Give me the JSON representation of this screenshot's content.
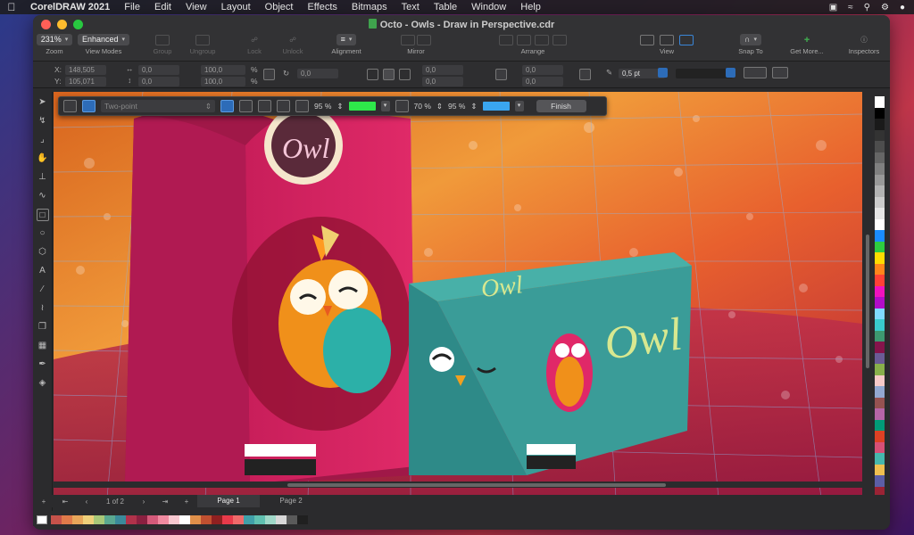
{
  "menubar": {
    "app_name": "CorelDRAW 2021",
    "items": [
      "File",
      "Edit",
      "View",
      "Layout",
      "Object",
      "Effects",
      "Bitmaps",
      "Text",
      "Table",
      "Window",
      "Help"
    ]
  },
  "window": {
    "title": "Octo - Owls - Draw in Perspective.cdr"
  },
  "toolbar": {
    "zoom_value": "231%",
    "zoom_label": "Zoom",
    "view_mode_value": "Enhanced",
    "view_mode_label": "View Modes",
    "group_label": "Group",
    "ungroup_label": "Ungroup",
    "lock_label": "Lock",
    "unlock_label": "Unlock",
    "alignment_label": "Alignment",
    "mirror_label": "Mirror",
    "arrange_label": "Arrange",
    "view_label": "View",
    "snap_label": "Snap To",
    "getmore_label": "Get More...",
    "inspectors_label": "Inspectors"
  },
  "propbar": {
    "x_label": "X:",
    "x_value": "148,505",
    "y_label": "Y:",
    "y_value": "105,071",
    "w_value": "0,0",
    "h_value": "0,0",
    "sw_value": "100,0",
    "sh_value": "100,0",
    "pct1": "%",
    "pct2": "%",
    "angle_value": "0,0",
    "corner1": "0,0",
    "corner2": "0,0",
    "corner3": "0,0",
    "corner4": "0,0",
    "outline_width": "0,5 pt"
  },
  "perspective_bar": {
    "mode_value": "Two-point",
    "opacity1": "95 %",
    "opacity2": "70 %",
    "opacity3": "95 %",
    "color1": "#2ee84a",
    "color2": "#3aa6f0",
    "finish_label": "Finish"
  },
  "canvas": {
    "bag_logo": "Owl",
    "box_logo_top": "Owl",
    "box_logo_side": "Owl"
  },
  "pagebar": {
    "page_count": "1 of 2",
    "pages": [
      "Page 1",
      "Page 2"
    ]
  },
  "palette_colors": [
    "#ffffff",
    "#000000",
    "#1a1a1a",
    "#333333",
    "#4d4d4d",
    "#666666",
    "#808080",
    "#999999",
    "#b3b3b3",
    "#cccccc",
    "#e6e6e6",
    "#ffffff",
    "#1a8cff",
    "#2ecc40",
    "#ffdc00",
    "#ff851b",
    "#ff4136",
    "#f012be",
    "#b10dc9",
    "#7fdbff",
    "#39cccc",
    "#3d9970",
    "#85144b",
    "#6b5b95",
    "#88b04b",
    "#f7cac9",
    "#92a8d1",
    "#955251",
    "#b565a7",
    "#009b77",
    "#dd4124",
    "#d65076",
    "#45b8ac",
    "#efc050",
    "#5b5ea6",
    "#9b2335"
  ],
  "doc_palette_colors": [
    "#c6524a",
    "#e07a4a",
    "#e8a65a",
    "#efd07a",
    "#a8c878",
    "#5aa890",
    "#3a8a9a",
    "#b0324a",
    "#8a2040",
    "#d45a7a",
    "#f08aa0",
    "#f8c8d0",
    "#ffffff",
    "#e0904a",
    "#c05030",
    "#902020",
    "#e83a4a",
    "#f06a6a",
    "#40a0a8",
    "#60c0b0",
    "#a0d8c8",
    "#d8d8d8",
    "#5a5a5a",
    "#202020"
  ]
}
